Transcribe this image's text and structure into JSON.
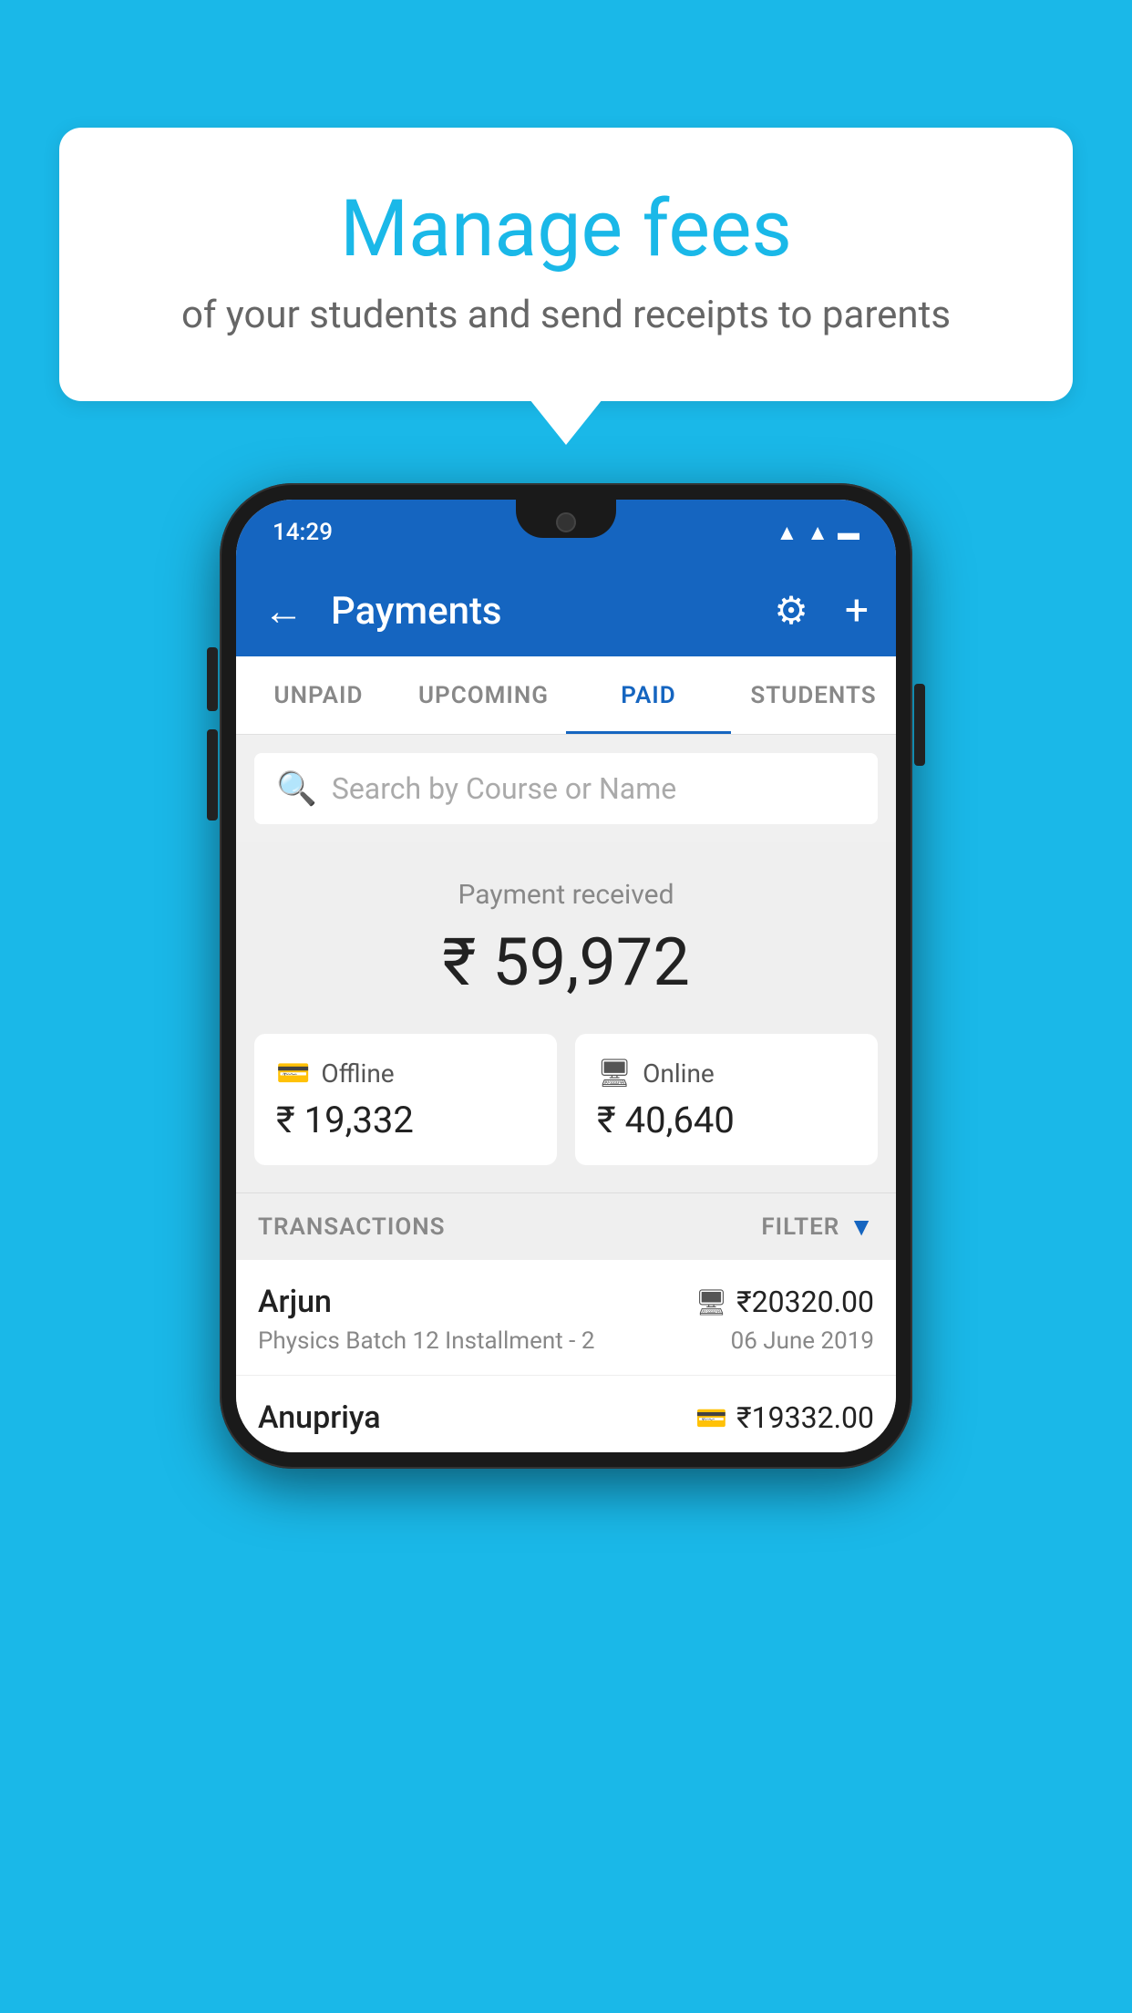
{
  "background_color": "#1ab8e8",
  "bubble": {
    "title": "Manage fees",
    "subtitle": "of your students and send receipts to parents"
  },
  "phone": {
    "status_bar": {
      "time": "14:29"
    },
    "header": {
      "title": "Payments",
      "back_label": "←",
      "gear_label": "⚙",
      "plus_label": "+"
    },
    "tabs": [
      {
        "label": "UNPAID",
        "active": false
      },
      {
        "label": "UPCOMING",
        "active": false
      },
      {
        "label": "PAID",
        "active": true
      },
      {
        "label": "STUDENTS",
        "active": false
      }
    ],
    "search": {
      "placeholder": "Search by Course or Name"
    },
    "payment_summary": {
      "label": "Payment received",
      "amount": "₹ 59,972",
      "offline": {
        "label": "Offline",
        "amount": "₹ 19,332"
      },
      "online": {
        "label": "Online",
        "amount": "₹ 40,640"
      }
    },
    "transactions": {
      "header_label": "TRANSACTIONS",
      "filter_label": "FILTER",
      "rows": [
        {
          "name": "Arjun",
          "amount": "₹20320.00",
          "description": "Physics Batch 12 Installment - 2",
          "date": "06 June 2019",
          "payment_type": "online"
        },
        {
          "name": "Anupriya",
          "amount": "₹19332.00",
          "description": "",
          "date": "",
          "payment_type": "offline"
        }
      ]
    }
  }
}
